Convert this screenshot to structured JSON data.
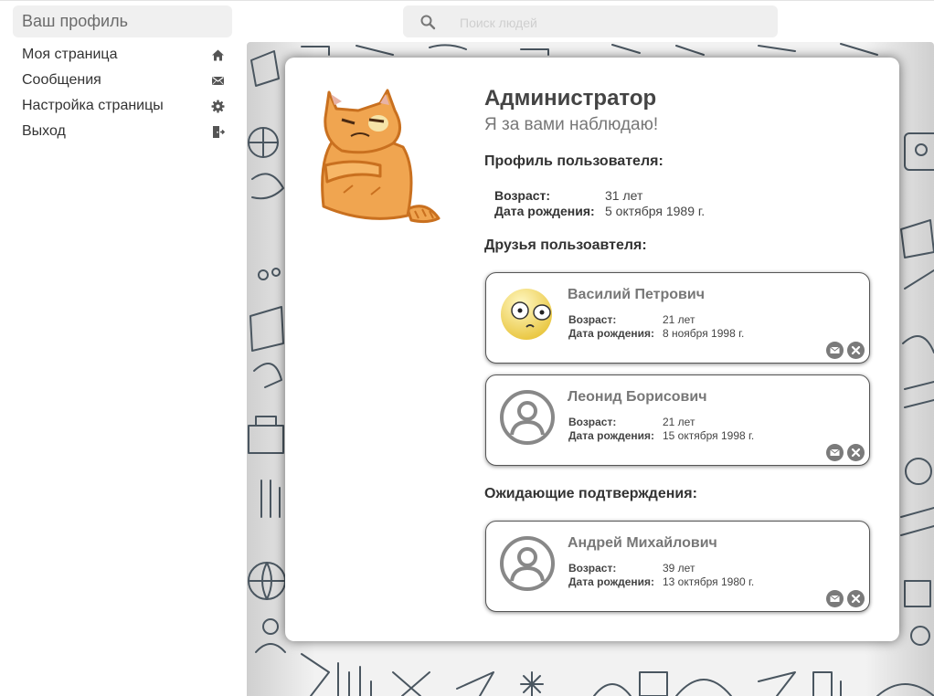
{
  "sidebar": {
    "header": "Ваш профиль",
    "items": [
      {
        "label": "Моя страница",
        "icon": "home-icon"
      },
      {
        "label": "Сообщения",
        "icon": "envelope-icon"
      },
      {
        "label": "Настройка страницы",
        "icon": "gear-icon"
      },
      {
        "label": "Выход",
        "icon": "logout-icon"
      }
    ]
  },
  "search": {
    "placeholder": "Поиск людей",
    "value": "",
    "icon": "search-icon"
  },
  "profile": {
    "avatar": "orange-cat-sticker",
    "name": "Администратор",
    "status": "Я за вами наблюдаю!",
    "section_title": "Профиль пользователя:",
    "age_label": "Возраст:",
    "age_value": "31 лет",
    "birth_label": "Дата рождения:",
    "birth_value": "5 октября 1989 г."
  },
  "friends": {
    "title": "Друзья пользоавтеля:",
    "items": [
      {
        "name": "Василий Петрович",
        "avatar": "confused-emoji",
        "age_label": "Возраст:",
        "age": "21 лет",
        "birth_label": "Дата рождения:",
        "birth": "8 ноября 1998 г."
      },
      {
        "name": "Леонид Борисович",
        "avatar": "default-user-icon",
        "age_label": "Возраст:",
        "age": "21 лет",
        "birth_label": "Дата рождения:",
        "birth": "15 октября 1998 г."
      }
    ]
  },
  "pending": {
    "title": "Ожидающие подтверждения:",
    "items": [
      {
        "name": "Андрей Михайлович",
        "avatar": "default-user-icon",
        "age_label": "Возраст:",
        "age": "39 лет",
        "birth_label": "Дата рождения:",
        "birth": "13 октября 1980 г."
      }
    ]
  },
  "colors": {
    "accent_gray": "#7a7a7a",
    "cat_orange": "#f0a550",
    "emoji_yellow": "#f7e37a",
    "background_doodles": "#4a5660"
  }
}
